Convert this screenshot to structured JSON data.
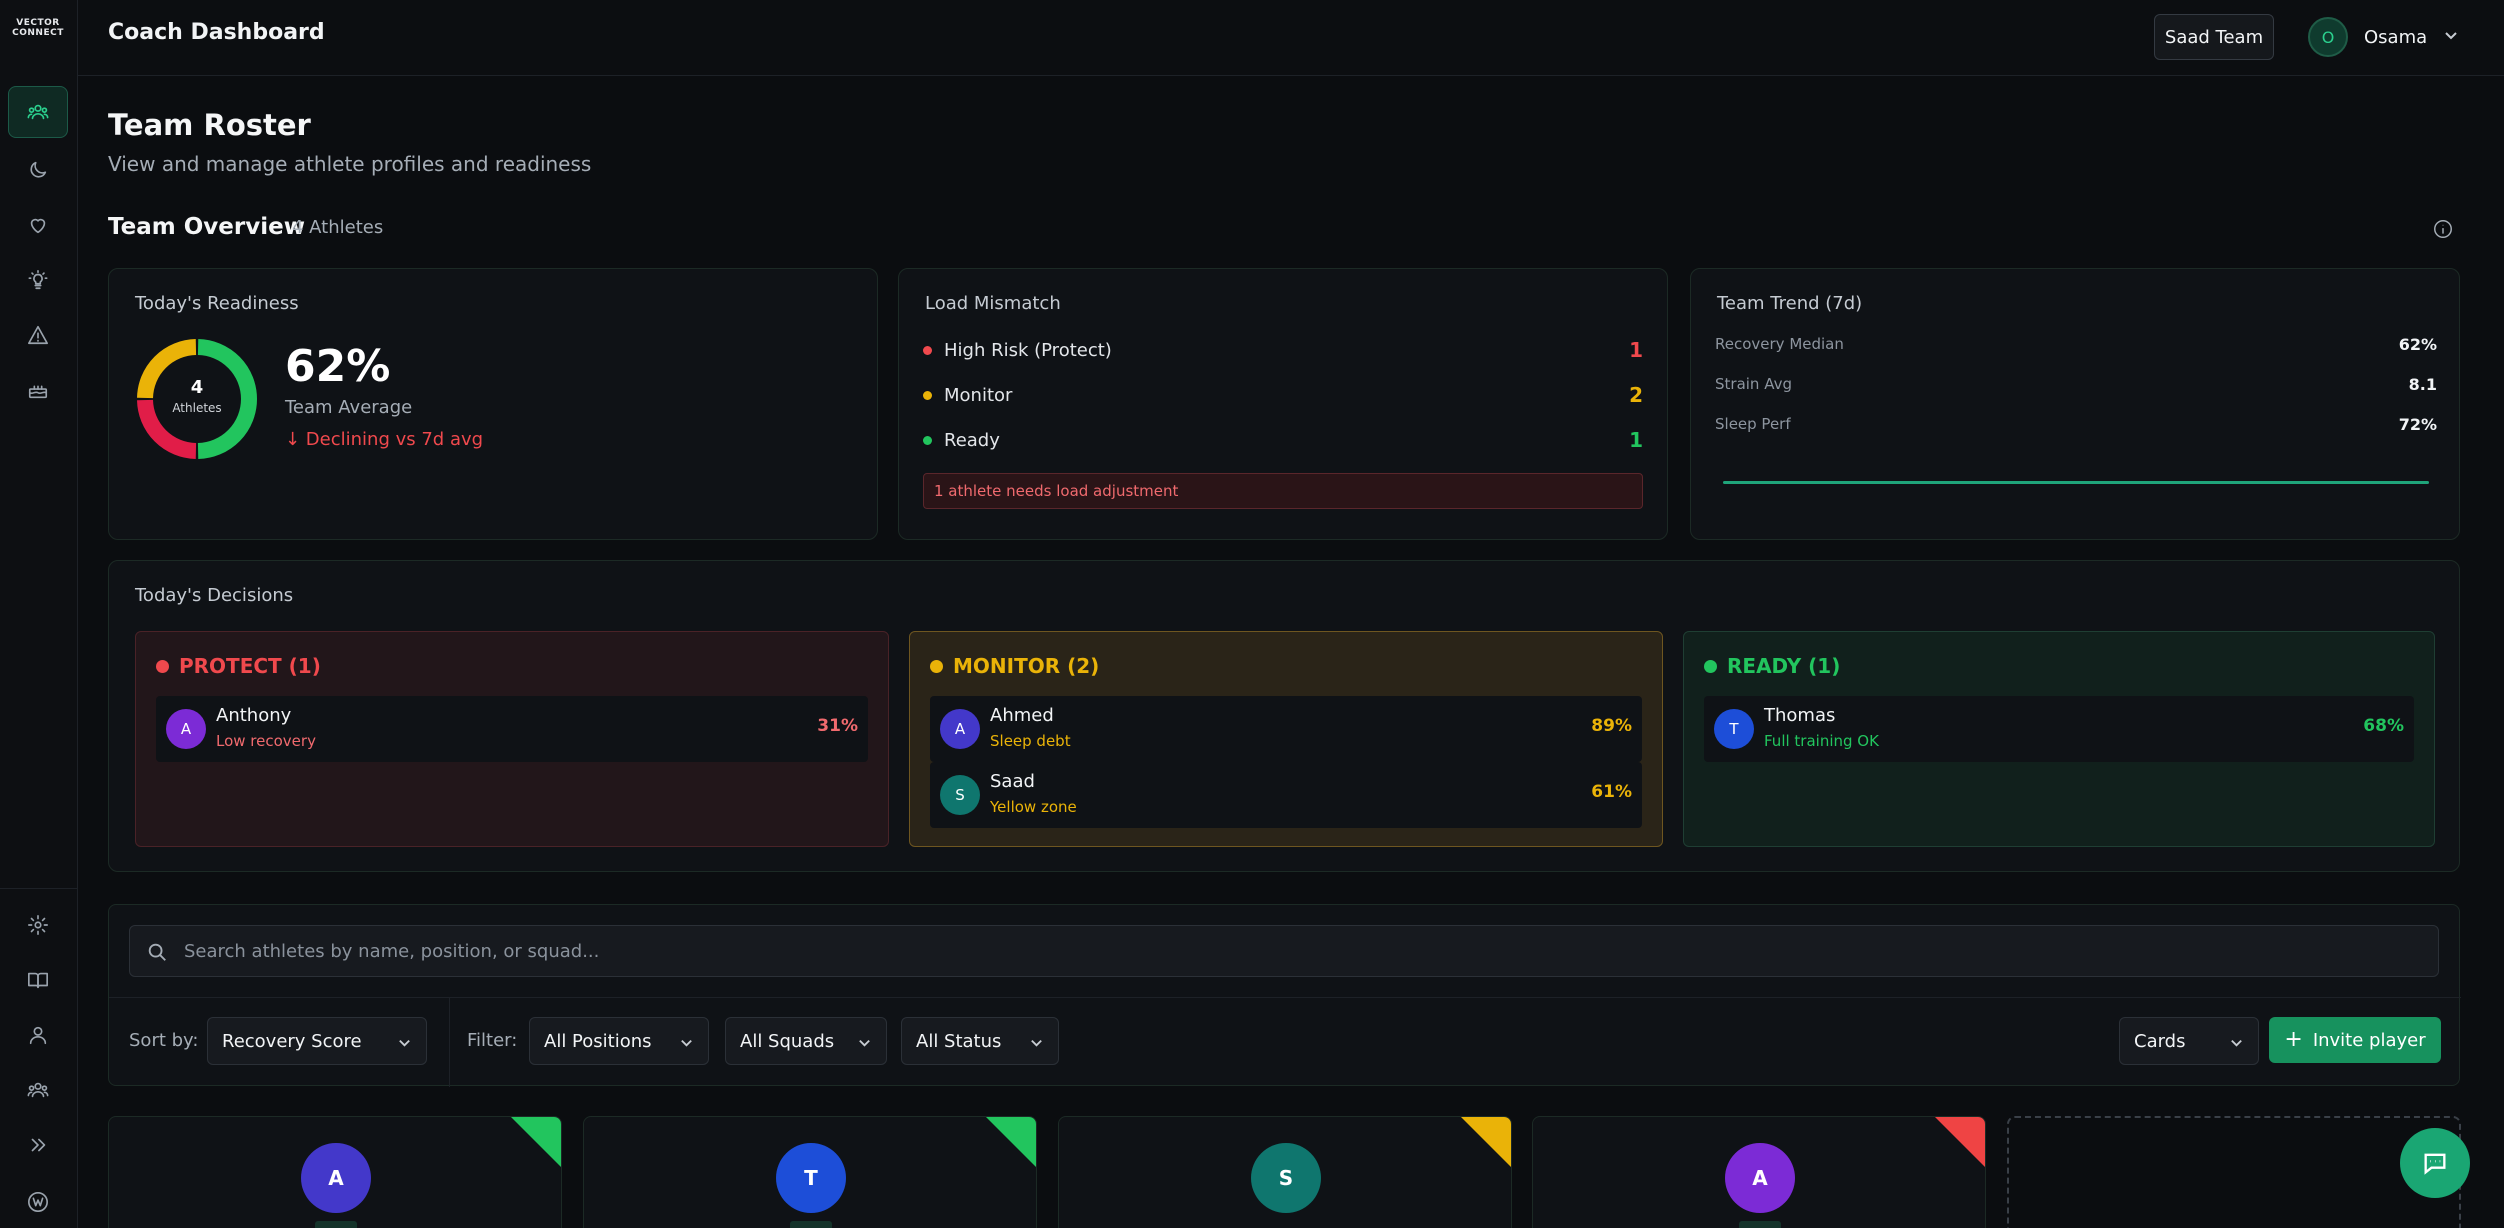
{
  "app": {
    "logo_line1": "VECTOR",
    "logo_line2": "CONNECT",
    "title": "Coach Dashboard"
  },
  "header": {
    "team_button": "Saad Team",
    "user_initial": "O",
    "user_name": "Osama"
  },
  "sidebar": {
    "items": [
      {
        "icon": "users-icon",
        "active": true
      },
      {
        "icon": "moon-icon"
      },
      {
        "icon": "heart-icon"
      },
      {
        "icon": "lightbulb-icon"
      },
      {
        "icon": "alert-triangle-icon"
      },
      {
        "icon": "cake-icon"
      }
    ],
    "bottom_items": [
      {
        "icon": "gear-icon"
      },
      {
        "icon": "book-icon"
      },
      {
        "icon": "user-icon"
      },
      {
        "icon": "team-icon"
      },
      {
        "icon": "double-chevron-right-icon"
      },
      {
        "icon": "brand-icon"
      }
    ]
  },
  "page": {
    "title": "Team Roster",
    "subtitle": "View and manage athlete profiles and readiness"
  },
  "overview": {
    "title": "Team Overview",
    "count": "4 Athletes"
  },
  "readiness": {
    "label": "Today's Readiness",
    "donut_center_num": "4",
    "donut_center_label": "Athletes",
    "value": "62%",
    "sub_label": "Team Average",
    "trend": "↓ Declining vs 7d avg",
    "segments": [
      {
        "status": "ready",
        "count": 2,
        "color": "#22c55e"
      },
      {
        "status": "protect",
        "count": 1,
        "color": "#e11d48"
      },
      {
        "status": "monitor",
        "count": 1,
        "color": "#eab308"
      }
    ]
  },
  "load_mismatch": {
    "label": "Load Mismatch",
    "rows": [
      {
        "label": "High Risk (Protect)",
        "value": "1",
        "color": "#f0494d"
      },
      {
        "label": "Monitor",
        "value": "2",
        "color": "#eab308"
      },
      {
        "label": "Ready",
        "value": "1",
        "color": "#22c55e"
      }
    ],
    "alert": "1 athlete needs load adjustment"
  },
  "team_trend": {
    "label": "Team Trend (7d)",
    "rows": [
      {
        "label": "Recovery Median",
        "value": "62%"
      },
      {
        "label": "Strain Avg",
        "value": "8.1"
      },
      {
        "label": "Sleep Perf",
        "value": "72%"
      }
    ]
  },
  "decisions": {
    "label": "Today's Decisions",
    "protect": {
      "title": "PROTECT (1)",
      "color": "#f0494d",
      "athletes": [
        {
          "initial": "A",
          "name": "Anthony",
          "note": "Low recovery",
          "pct": "31%",
          "avatar_color": "#7c2bd6"
        }
      ]
    },
    "monitor": {
      "title": "MONITOR (2)",
      "color": "#eab308",
      "athletes": [
        {
          "initial": "A",
          "name": "Ahmed",
          "note": "Sleep debt",
          "pct": "89%",
          "avatar_color": "#4338ca"
        },
        {
          "initial": "S",
          "name": "Saad",
          "note": "Yellow zone",
          "pct": "61%",
          "avatar_color": "#0f766e"
        }
      ]
    },
    "ready": {
      "title": "READY (1)",
      "color": "#22c55e",
      "athletes": [
        {
          "initial": "T",
          "name": "Thomas",
          "note": "Full training OK",
          "pct": "68%",
          "avatar_color": "#1d4ed8"
        }
      ]
    }
  },
  "filters": {
    "search_placeholder": "Search athletes by name, position, or squad...",
    "sort_label": "Sort by:",
    "sort_value": "Recovery Score",
    "filter_label": "Filter:",
    "positions": "All Positions",
    "squads": "All Squads",
    "status": "All Status",
    "view": "Cards",
    "invite": "Invite player",
    "invite_plus": "+"
  },
  "cards": [
    {
      "initial": "A",
      "avatar_color": "#4338ca",
      "corner": "#22c55e"
    },
    {
      "initial": "T",
      "avatar_color": "#1d4ed8",
      "corner": "#22c55e"
    },
    {
      "initial": "S",
      "avatar_color": "#0f766e",
      "corner": "#eab308"
    },
    {
      "initial": "A",
      "avatar_color": "#7c2bd6",
      "corner": "#ef4444"
    }
  ]
}
